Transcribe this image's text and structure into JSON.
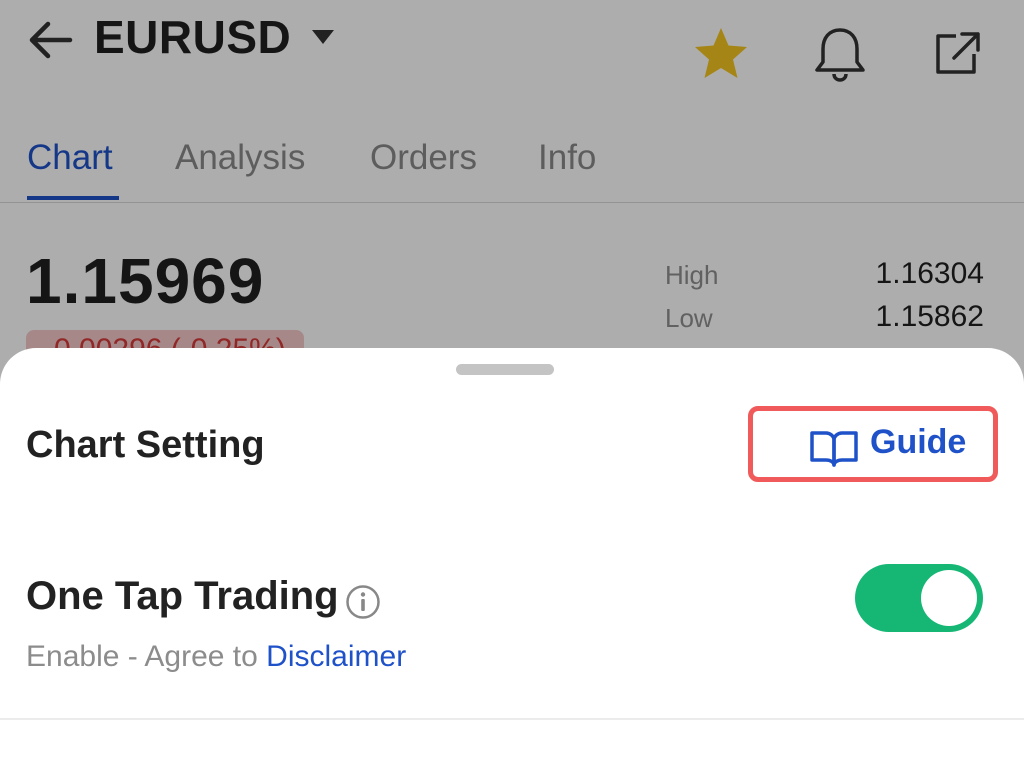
{
  "header": {
    "symbol": "EURUSD",
    "icons": [
      "back-arrow-icon",
      "caret-down-icon",
      "star-icon",
      "bell-icon",
      "share-icon"
    ],
    "favorite_color": "#f4c51f"
  },
  "tabs": [
    {
      "label": "Chart",
      "active": true
    },
    {
      "label": "Analysis",
      "active": false
    },
    {
      "label": "Orders",
      "active": false
    },
    {
      "label": "Info",
      "active": false
    }
  ],
  "quote": {
    "price": "1.15969",
    "change": "-0.00296 (-0.25%)",
    "high_label": "High",
    "high_value": "1.16304",
    "low_label": "Low",
    "low_value": "1.15862"
  },
  "sheet": {
    "title": "Chart Setting",
    "guide_label": "Guide",
    "setting_title": "One Tap Trading",
    "setting_sub_prefix": "Enable - Agree to ",
    "disclaimer_link": "Disclaimer",
    "toggle_on": true,
    "accent_color": "#1f52c9",
    "toggle_color": "#16b774",
    "highlight_color": "#f05a5a"
  }
}
